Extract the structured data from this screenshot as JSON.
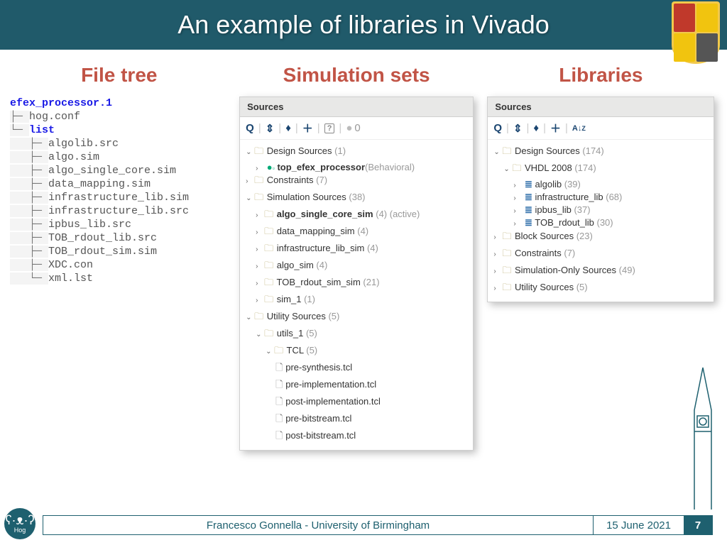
{
  "title": "An example of libraries in Vivado",
  "columns": {
    "filetree_heading": "File tree",
    "simsets_heading": "Simulation sets",
    "libs_heading": "Libraries"
  },
  "filetree": {
    "root": "efex_processor.1",
    "items": [
      "hog.conf",
      "list",
      "algolib.src",
      "algo.sim",
      "algo_single_core.sim",
      "data_mapping.sim",
      "infrastructure_lib.sim",
      "infrastructure_lib.src",
      "ipbus_lib.src",
      "TOB_rdout_lib.src",
      "TOB_rdout_sim.sim",
      "XDC.con",
      "xml.lst"
    ]
  },
  "simpanel": {
    "header": "Sources",
    "toolbar_zero": "0",
    "tree": {
      "design_sources": {
        "label": "Design Sources",
        "count": "(1)"
      },
      "top": "top_efex_processor",
      "top_note": "(Behavioral)",
      "constraints": {
        "label": "Constraints",
        "count": "(7)"
      },
      "sim_sources": {
        "label": "Simulation Sources",
        "count": "(38)"
      },
      "sims": [
        {
          "label": "algo_single_core_sim",
          "count": "(4)",
          "bold": true,
          "active": "(active)"
        },
        {
          "label": "data_mapping_sim",
          "count": "(4)"
        },
        {
          "label": "infrastructure_lib_sim",
          "count": "(4)"
        },
        {
          "label": "algo_sim",
          "count": "(4)"
        },
        {
          "label": "TOB_rdout_sim_sim",
          "count": "(21)"
        },
        {
          "label": "sim_1",
          "count": "(1)"
        }
      ],
      "utility": {
        "label": "Utility Sources",
        "count": "(5)"
      },
      "utils1": {
        "label": "utils_1",
        "count": "(5)"
      },
      "tcl": {
        "label": "TCL",
        "count": "(5)"
      },
      "tcls": [
        "pre-synthesis.tcl",
        "pre-implementation.tcl",
        "post-implementation.tcl",
        "pre-bitstream.tcl",
        "post-bitstream.tcl"
      ]
    }
  },
  "libpanel": {
    "header": "Sources",
    "tree": {
      "design_sources": {
        "label": "Design Sources",
        "count": "(174)"
      },
      "vhdl": {
        "label": "VHDL 2008",
        "count": "(174)"
      },
      "libs": [
        {
          "label": "algolib",
          "count": "(39)"
        },
        {
          "label": "infrastructure_lib",
          "count": "(68)"
        },
        {
          "label": "ipbus_lib",
          "count": "(37)"
        },
        {
          "label": "TOB_rdout_lib",
          "count": "(30)"
        }
      ],
      "block": {
        "label": "Block Sources",
        "count": "(23)"
      },
      "constraints": {
        "label": "Constraints",
        "count": "(7)"
      },
      "simonly": {
        "label": "Simulation-Only Sources",
        "count": "(49)"
      },
      "utility": {
        "label": "Utility Sources",
        "count": "(5)"
      }
    }
  },
  "footer": {
    "author": "Francesco Gonnella - University of Birmingham",
    "date": "15 June 2021",
    "page": "7",
    "logo_label": "Hog"
  }
}
